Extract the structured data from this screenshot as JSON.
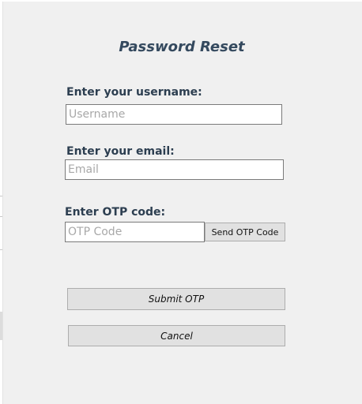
{
  "window": {
    "title": "Password Reset"
  },
  "form": {
    "username_label": "Enter your username:",
    "username_placeholder": "Username",
    "username_value": "",
    "email_label": "Enter your email:",
    "email_placeholder": "Email",
    "email_value": "",
    "otp_label": "Enter OTP code:",
    "otp_placeholder": "OTP Code",
    "otp_value": ""
  },
  "buttons": {
    "send_otp_label": "Send OTP Code",
    "submit_otp_label": "Submit OTP",
    "cancel_label": "Cancel"
  },
  "colors": {
    "background": "#f0f0f0",
    "title_color": "#34495e",
    "label_color": "#2c3e50",
    "button_face": "#e1e1e1"
  }
}
